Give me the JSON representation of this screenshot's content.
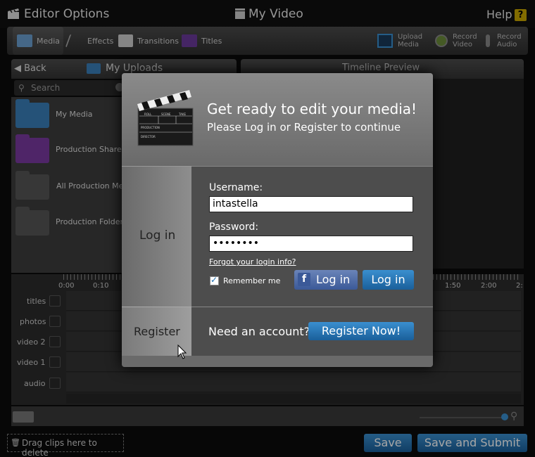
{
  "topbar": {
    "app_title": "Editor Options",
    "doc_title": "My Video",
    "help": "Help",
    "help_icon": "?"
  },
  "toolbar": {
    "tabs": [
      {
        "label": "Media",
        "icon": "media-icon"
      },
      {
        "label": "Effects",
        "icon": "effects-icon"
      },
      {
        "label": "Transitions",
        "icon": "transitions-icon"
      },
      {
        "label": "Titles",
        "icon": "titles-icon"
      }
    ],
    "actions": [
      {
        "line1": "Upload",
        "line2": "Media",
        "icon": "upload-icon"
      },
      {
        "line1": "Record",
        "line2": "Video",
        "icon": "webcam-icon"
      },
      {
        "line1": "Record",
        "line2": "Audio",
        "icon": "microphone-icon"
      }
    ]
  },
  "uploads": {
    "back": "Back",
    "title": "My Uploads",
    "search_placeholder": "Search",
    "folders": [
      {
        "label": "My Media",
        "color": "#3a7fb8"
      },
      {
        "label": "Production Shared",
        "color": "#7a3aa0"
      },
      {
        "label": "All Production Med",
        "color": "#555555"
      },
      {
        "label": "Production Folders",
        "color": "#555555"
      }
    ]
  },
  "preview": {
    "title": "Timeline Preview"
  },
  "timeline": {
    "ticks_left": [
      "0:00",
      "0:10"
    ],
    "ticks_right": [
      "1:50",
      "2:00",
      "2:"
    ],
    "tracks": [
      "titles",
      "photos",
      "video 2",
      "video 1",
      "audio"
    ]
  },
  "footer": {
    "drag_hint": "Drag clips here to delete",
    "save": "Save",
    "save_submit": "Save and Submit"
  },
  "modal": {
    "heading": "Get ready to edit your media!",
    "subheading": "Please Log in or Register to continue",
    "login_tab": "Log in",
    "register_tab": "Register",
    "username_label": "Username:",
    "username_value": "intastella",
    "password_label": "Password:",
    "password_value": "••••••••",
    "forgot": "Forgot your login info?",
    "remember": "Remember me",
    "fb_login": "Log in",
    "login_button": "Log in",
    "need_account": "Need an account?",
    "register_button": "Register Now!"
  },
  "clapper": {
    "roll": "ROLL",
    "scene": "SCENE",
    "take": "TAKE",
    "production": "PRODUCTION",
    "director": "DIRECTOR"
  }
}
